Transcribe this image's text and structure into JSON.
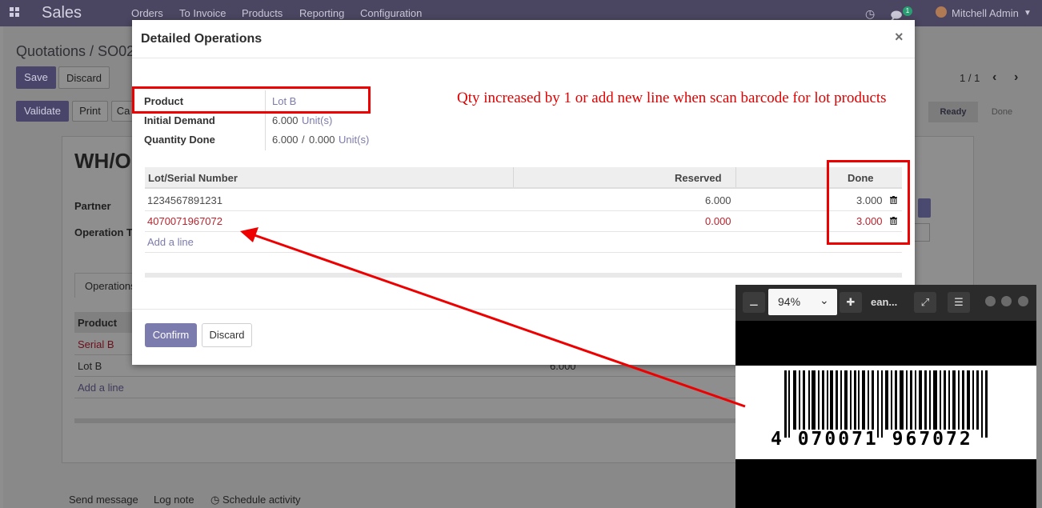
{
  "navbar": {
    "brand": "Sales",
    "menu": [
      "Orders",
      "To Invoice",
      "Products",
      "Reporting",
      "Configuration"
    ],
    "message_count": "1",
    "user": "Mitchell Admin"
  },
  "background": {
    "breadcrumb": "Quotations / SO02",
    "save_label": "Save",
    "discard_label": "Discard",
    "validate_label": "Validate",
    "print_label": "Print",
    "cancel_label_partial": "Ca",
    "pager": "1 / 1",
    "status_ready": "Ready",
    "status_done": "Done",
    "record_title": "WH/O",
    "partner_label": "Partner",
    "operation_type_label": "Operation T",
    "tab_operations": "Operations",
    "ops_col_product": "Product",
    "ops_rows": [
      {
        "product": "Serial B"
      },
      {
        "product": "Lot B",
        "qty": "6.000"
      }
    ],
    "add_line": "Add a line",
    "send_message": "Send message",
    "log_note": "Log note",
    "schedule_activity": "Schedule activity"
  },
  "modal": {
    "title": "Detailed Operations",
    "close": "×",
    "product_label": "Product",
    "product_value": "Lot B",
    "initial_demand_label": "Initial Demand",
    "initial_demand_value": "6.000",
    "initial_demand_uom": "Unit(s)",
    "quantity_done_label": "Quantity Done",
    "quantity_done_value": "6.000",
    "quantity_done_sep": "/",
    "quantity_done_reserved": "0.000",
    "quantity_done_uom": "Unit(s)",
    "annotation": "Qty increased by 1 or add new line when scan barcode for lot products",
    "columns": {
      "lot": "Lot/Serial Number",
      "reserved": "Reserved",
      "done": "Done"
    },
    "rows": [
      {
        "lot": "1234567891231",
        "reserved": "6.000",
        "done": "3.000"
      },
      {
        "lot": "4070071967072",
        "reserved": "0.000",
        "done": "3.000"
      }
    ],
    "add_line": "Add a line",
    "confirm_label": "Confirm",
    "discard_label": "Discard"
  },
  "viewer": {
    "zoom": "94%",
    "title": "ean...",
    "barcode_digits": "4 070071 967072"
  },
  "colors": {
    "navbar": "#4a4560",
    "primary": "#7c7bad",
    "annotation_red": "#ee0000",
    "new_line_red": "#b8242e"
  }
}
